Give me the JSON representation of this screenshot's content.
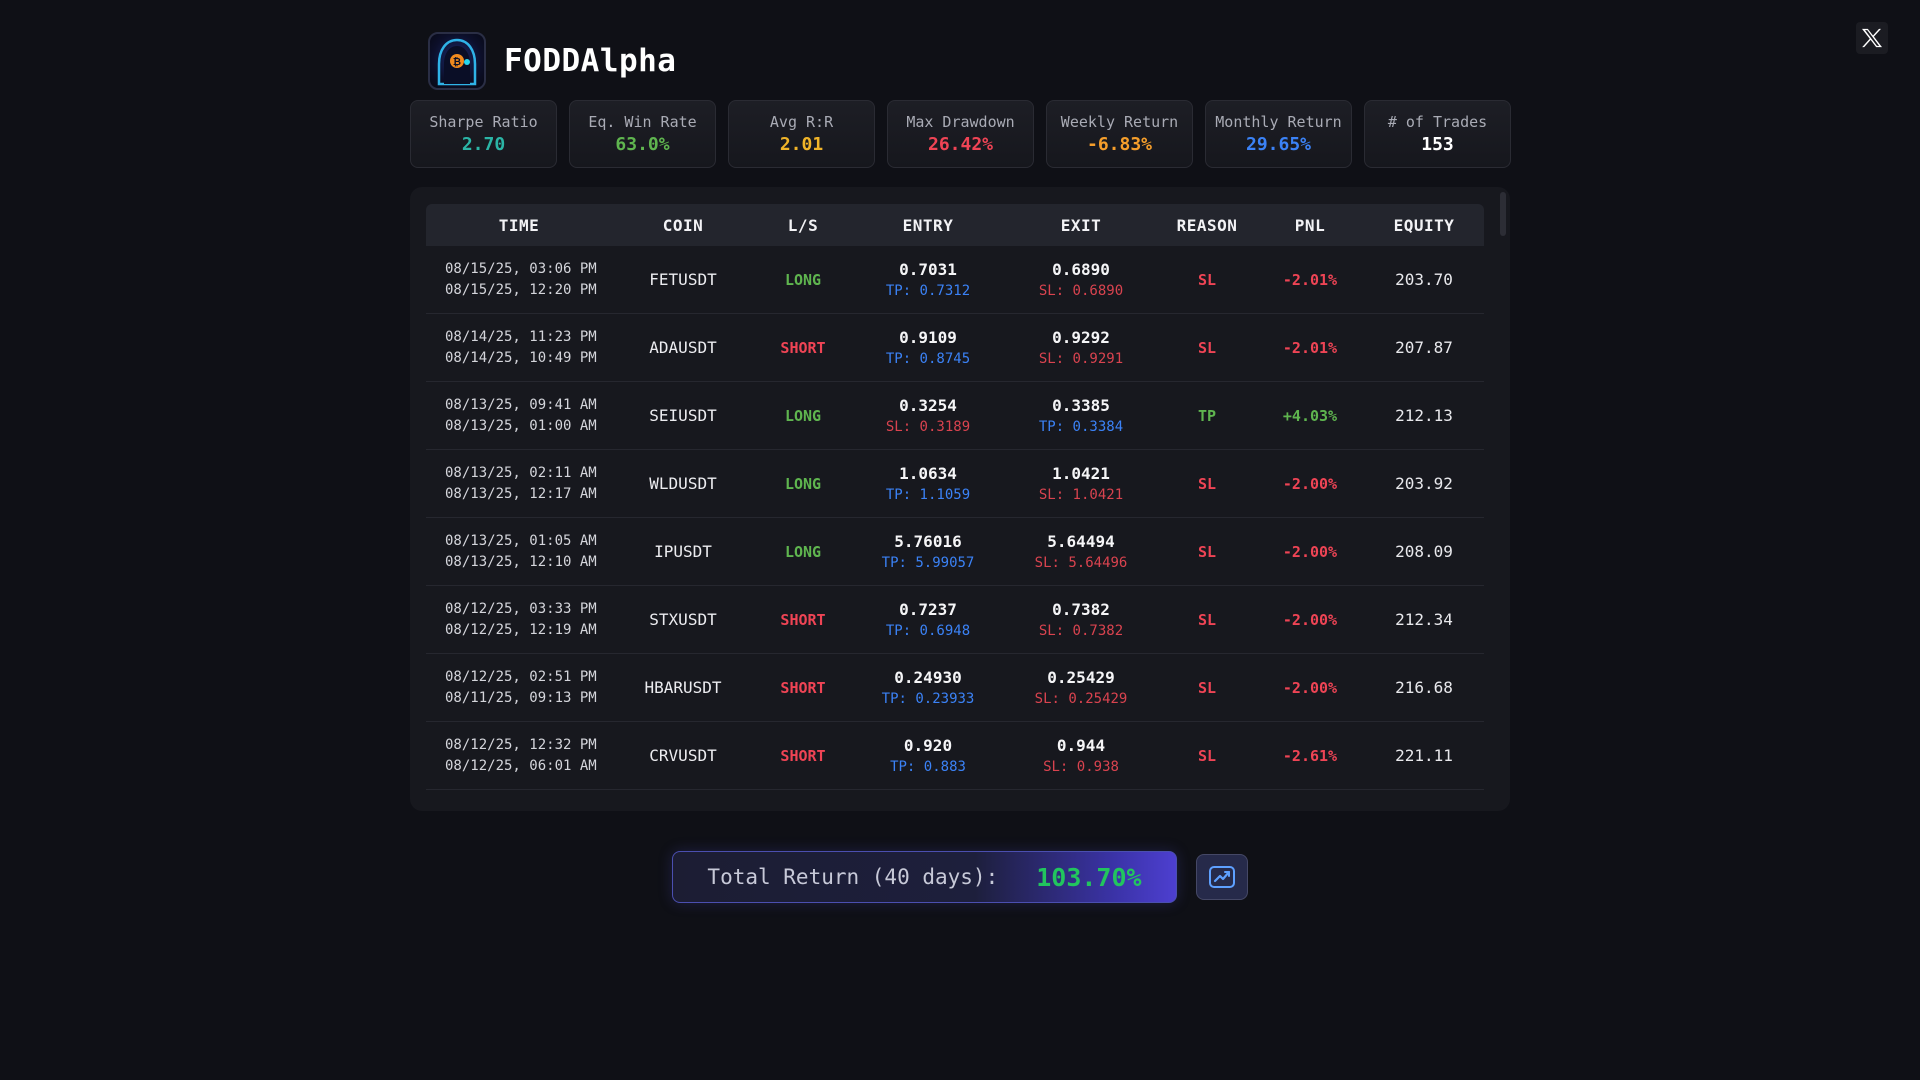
{
  "brand": {
    "name": "FODDAlpha"
  },
  "stats": [
    {
      "label": "Sharpe Ratio",
      "value": "2.70",
      "color": "#2bb5a6"
    },
    {
      "label": "Eq. Win Rate",
      "value": "63.0%",
      "color": "#5fb54f"
    },
    {
      "label": "Avg R:R",
      "value": "2.01",
      "color": "#f0b429"
    },
    {
      "label": "Max Drawdown",
      "value": "26.42%",
      "color": "#ef4455"
    },
    {
      "label": "Weekly Return",
      "value": "-6.83%",
      "color": "#f59e2b"
    },
    {
      "label": "Monthly Return",
      "value": "29.65%",
      "color": "#3b82f6"
    },
    {
      "label": "# of Trades",
      "value": "153",
      "color": "#ffffff"
    }
  ],
  "table": {
    "headers": [
      "TIME",
      "COIN",
      "L/S",
      "ENTRY",
      "EXIT",
      "REASON",
      "PNL",
      "EQUITY"
    ],
    "rows": [
      {
        "time_exit": "08/15/25, 03:06 PM",
        "time_entry": "08/15/25, 12:20 PM",
        "coin": "FETUSDT",
        "side": "LONG",
        "entry": "0.7031",
        "entry_sub": "TP: 0.7312",
        "exit": "0.6890",
        "exit_sub": "SL: 0.6890",
        "reason": "SL",
        "pnl": "-2.01%",
        "equity": "203.70"
      },
      {
        "time_exit": "08/14/25, 11:23 PM",
        "time_entry": "08/14/25, 10:49 PM",
        "coin": "ADAUSDT",
        "side": "SHORT",
        "entry": "0.9109",
        "entry_sub": "TP: 0.8745",
        "exit": "0.9292",
        "exit_sub": "SL: 0.9291",
        "reason": "SL",
        "pnl": "-2.01%",
        "equity": "207.87"
      },
      {
        "time_exit": "08/13/25, 09:41 AM",
        "time_entry": "08/13/25, 01:00 AM",
        "coin": "SEIUSDT",
        "side": "LONG",
        "entry": "0.3254",
        "entry_sub": "SL: 0.3189",
        "exit": "0.3385",
        "exit_sub": "TP: 0.3384",
        "reason": "TP",
        "pnl": "+4.03%",
        "equity": "212.13"
      },
      {
        "time_exit": "08/13/25, 02:11 AM",
        "time_entry": "08/13/25, 12:17 AM",
        "coin": "WLDUSDT",
        "side": "LONG",
        "entry": "1.0634",
        "entry_sub": "TP: 1.1059",
        "exit": "1.0421",
        "exit_sub": "SL: 1.0421",
        "reason": "SL",
        "pnl": "-2.00%",
        "equity": "203.92"
      },
      {
        "time_exit": "08/13/25, 01:05 AM",
        "time_entry": "08/13/25, 12:10 AM",
        "coin": "IPUSDT",
        "side": "LONG",
        "entry": "5.76016",
        "entry_sub": "TP: 5.99057",
        "exit": "5.64494",
        "exit_sub": "SL: 5.64496",
        "reason": "SL",
        "pnl": "-2.00%",
        "equity": "208.09"
      },
      {
        "time_exit": "08/12/25, 03:33 PM",
        "time_entry": "08/12/25, 12:19 AM",
        "coin": "STXUSDT",
        "side": "SHORT",
        "entry": "0.7237",
        "entry_sub": "TP: 0.6948",
        "exit": "0.7382",
        "exit_sub": "SL: 0.7382",
        "reason": "SL",
        "pnl": "-2.00%",
        "equity": "212.34"
      },
      {
        "time_exit": "08/12/25, 02:51 PM",
        "time_entry": "08/11/25, 09:13 PM",
        "coin": "HBARUSDT",
        "side": "SHORT",
        "entry": "0.24930",
        "entry_sub": "TP: 0.23933",
        "exit": "0.25429",
        "exit_sub": "SL: 0.25429",
        "reason": "SL",
        "pnl": "-2.00%",
        "equity": "216.68"
      },
      {
        "time_exit": "08/12/25, 12:32 PM",
        "time_entry": "08/12/25, 06:01 AM",
        "coin": "CRVUSDT",
        "side": "SHORT",
        "entry": "0.920",
        "entry_sub": "TP: 0.883",
        "exit": "0.944",
        "exit_sub": "SL: 0.938",
        "reason": "SL",
        "pnl": "-2.61%",
        "equity": "221.11"
      }
    ]
  },
  "colors": {
    "long": "#5fb54f",
    "short": "#ef4455",
    "tp": "#3b82f6",
    "sl": "#d9434f",
    "gain": "#5fb54f",
    "loss": "#ef4455"
  },
  "footer": {
    "total_label": "Total Return (40 days):",
    "total_value": "103.70%"
  },
  "icons": {
    "close": "x-logo-icon",
    "chart": "chart-line-icon"
  }
}
